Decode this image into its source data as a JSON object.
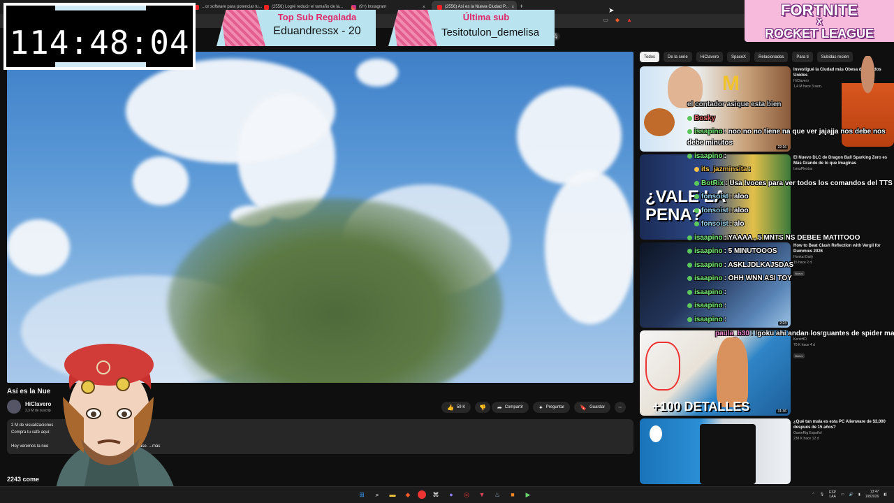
{
  "browser": {
    "tabs": [
      {
        "label": "...or software para potenciar tu...",
        "active": false,
        "icon": "youtube-icon"
      },
      {
        "label": "(2556) Logré reducir el tamaño de la...",
        "active": false,
        "icon": "youtube-icon"
      },
      {
        "label": "(9+) Instagram",
        "active": false,
        "icon": "instagram-icon"
      },
      {
        "label": "(2556) Así es la Nueva Ciudad P...",
        "active": true,
        "icon": "youtube-icon"
      }
    ],
    "new_tab": "+",
    "tab_close": "×"
  },
  "overlay": {
    "timer": "114:48:04",
    "top_sub_label": "Top Sub Regalada",
    "top_sub_value": "Eduandressx - 20",
    "last_sub_label": "Última sub",
    "last_sub_value": "Tesitotulon_demelisa",
    "fortnite_line1": "FORTNITE",
    "fortnite_line2": "X",
    "fortnite_line3": "ROCKET LEAGUE"
  },
  "video": {
    "title": "Así es la Nue",
    "channel": "HiClavero",
    "subs": "2,3 M de suscrip",
    "actions": {
      "likes": "59 K",
      "share": "Compartir",
      "ask": "Preguntar",
      "save": "Guardar",
      "more": "⋯"
    },
    "description": {
      "views": "2 M de visualizaciones",
      "line2": "Compra tu café aquí:",
      "line3": "Hoy veremos la nue",
      "line3_end": "ase.  ...más"
    },
    "comments": "2243 come"
  },
  "sidebar": {
    "chips": [
      "Todos",
      "De la serie",
      "HiClavero",
      "SpaceX",
      "Relacionados",
      "Para ti",
      "Subidas recien"
    ],
    "recs": [
      {
        "title": "Investigué la Ciudad más Obesa de Estados Unidos",
        "channel": "HiClavero",
        "stats": "1,4 M  hace 3 sem.",
        "duration": "22:16"
      },
      {
        "title": "El Nuevo DLC de Dragon Ball Sparking Zero es Más Grande de lo que Imaginas",
        "channel": "IsmaPlestos",
        "stats": "",
        "duration": ""
      },
      {
        "title": "How to Beat Clash Reflection with Vergil for Dummies 2026",
        "channel": "Honkai Daily",
        "stats": "15  hace 2 d",
        "duration": "2:24",
        "badge": "Nuevo"
      },
      {
        "title": "... Antes de GTA 6",
        "channel": "KerstHD",
        "stats": "70 K  hace 4 d",
        "duration": "31:36",
        "badge": "Nuevo"
      },
      {
        "title": "¿Qué tan mala es esta PC Alienware de $3,000 después de 15 años?",
        "channel": "GameRig Español",
        "stats": "238 K  hace 12 d",
        "duration": ""
      }
    ],
    "thumb_text": {
      "dragon1": "¿VALE LA",
      "dragon2": "PENA?",
      "gta": "+100 DETALLES"
    }
  },
  "chat": [
    {
      "user": "",
      "text": "el contador asique esta bien",
      "color": "#cfcfcf"
    },
    {
      "user": "Bosky",
      "text": "",
      "color": "#e86b6b"
    },
    {
      "user": "isaapino",
      "text": ": noo no no tiene na que ver jajajja nos debe nos",
      "color": "#7cf27c"
    },
    {
      "user": "",
      "text": "debe minutos",
      "color": "#ffffff"
    },
    {
      "user": "isaapino",
      "text": ":",
      "color": "#7cf27c"
    },
    {
      "user": "its_jazminsita",
      "text": ":",
      "color": "#f3c24a"
    },
    {
      "user": "BotRix",
      "text": ": Usa !voces para ver todos los comandos del TTS",
      "color": "#7cf27c"
    },
    {
      "user": "fonsoist",
      "text": ": aloo",
      "color": "#9ad7f5"
    },
    {
      "user": "fonsoist",
      "text": ": aloo",
      "color": "#9ad7f5"
    },
    {
      "user": "fonsoist",
      "text": ": alo",
      "color": "#9ad7f5"
    },
    {
      "user": "isaapino",
      "text": ": YAAAA , 5 MNTS NS DEBEE MATITOOO",
      "color": "#7cf27c"
    },
    {
      "user": "isaapino",
      "text": ": 5 MINUTOOOS",
      "color": "#7cf27c"
    },
    {
      "user": "isaapino",
      "text": ": ASKLJDLKAJSDAS",
      "color": "#7cf27c"
    },
    {
      "user": "isaapino",
      "text": ": OHH WNN ASI TOY",
      "color": "#7cf27c"
    },
    {
      "user": "isaapino",
      "text": ":",
      "color": "#7cf27c"
    },
    {
      "user": "isaapino",
      "text": ":",
      "color": "#7cf27c"
    },
    {
      "user": "isaapino",
      "text": ":",
      "color": "#7cf27c"
    },
    {
      "user": "paula_b30",
      "text": ": !goku ahí andan los guantes de spider man",
      "color": "#f08ad0"
    }
  ],
  "taskbar": {
    "lang1": "ESP",
    "lang2": "LAA",
    "time": "13:47",
    "date": "1/8/2026"
  },
  "colors": {
    "youtube_bg": "#0f0f0f",
    "accent_pink": "#e0286a",
    "banner_bg": "#b9e3ee"
  }
}
